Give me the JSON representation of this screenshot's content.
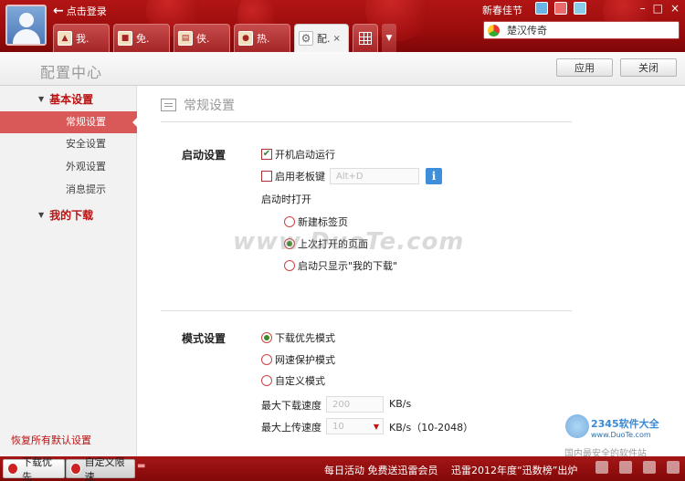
{
  "header": {
    "login_text": "点击登录",
    "festival": "新春佳节",
    "search_value": "楚汉传奇",
    "tabs": [
      {
        "label": "我.",
        "icon": "home-icon"
      },
      {
        "label": "免.",
        "icon": "movie-icon"
      },
      {
        "label": "侠.",
        "icon": "film-icon"
      },
      {
        "label": "热.",
        "icon": "camera-icon"
      },
      {
        "label": "配.",
        "icon": "gear-icon",
        "active": true
      }
    ]
  },
  "config": {
    "title": "配置中心",
    "apply": "应用",
    "close": "关闭"
  },
  "sidebar": {
    "group1": "基本设置",
    "items": [
      "常规设置",
      "安全设置",
      "外观设置",
      "消息提示"
    ],
    "group2": "我的下载",
    "restore": "恢复所有默认设置"
  },
  "main": {
    "section_title": "常规设置",
    "startup": {
      "label": "启动设置",
      "autorun": "开机启动运行",
      "boss_key": "启用老板键",
      "boss_key_value": "Alt+D",
      "on_open": "启动时打开",
      "options": [
        "新建标签页",
        "上次打开的页面",
        "启动只显示\"我的下载\""
      ],
      "selected_index": 1
    },
    "mode": {
      "label": "模式设置",
      "options": [
        "下载优先模式",
        "网速保护模式",
        "自定义模式"
      ],
      "selected_index": 0,
      "max_down_label": "最大下载速度",
      "max_down_value": "200",
      "max_down_unit": "KB/s",
      "max_up_label": "最大上传速度",
      "max_up_value": "10",
      "max_up_unit": "KB/s（10-2048）"
    }
  },
  "watermark": {
    "center": "www.DuoTe.com",
    "brand": "2345软件大全",
    "url": "www.DuoTe.com",
    "slogan": "国内最安全的软件站"
  },
  "bottom": {
    "download_first": "下载优先",
    "custom_limit": "自定义限速",
    "promo1": "每日活动 免费送迅雷会员",
    "promo2": "迅雷2012年度“迅数榜”出炉"
  }
}
